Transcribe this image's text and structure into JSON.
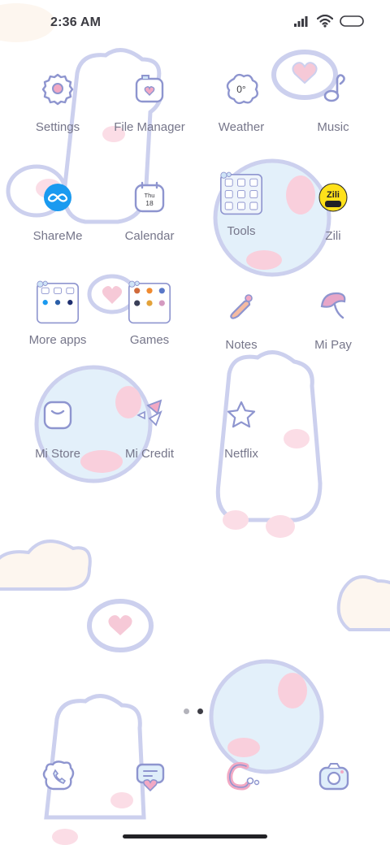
{
  "status_bar": {
    "time": "2:36 AM",
    "icons": [
      "signal-icon",
      "wifi-icon",
      "battery-icon"
    ]
  },
  "apps": [
    {
      "label": "Settings",
      "icon": "gear-icon"
    },
    {
      "label": "File Manager",
      "icon": "folder-icon"
    },
    {
      "label": "Weather",
      "icon": "weather-icon",
      "icon_text": "0°"
    },
    {
      "label": "Music",
      "icon": "music-note-icon"
    },
    {
      "label": "ShareMe",
      "icon": "shareme-icon"
    },
    {
      "label": "Calendar",
      "icon": "calendar-icon",
      "day": "Thu",
      "date": "18"
    },
    {
      "label": "Tools",
      "icon": "folder-tools-icon"
    },
    {
      "label": "Zili",
      "icon": "zili-icon",
      "icon_text": "Zili"
    },
    {
      "label": "More apps",
      "icon": "folder-more-apps-icon"
    },
    {
      "label": "Games",
      "icon": "folder-games-icon"
    },
    {
      "label": "Notes",
      "icon": "notes-icon"
    },
    {
      "label": "Mi Pay",
      "icon": "mi-pay-icon"
    },
    {
      "label": "Mi Store",
      "icon": "mi-store-icon"
    },
    {
      "label": "Mi Credit",
      "icon": "mi-credit-icon"
    },
    {
      "label": "Netflix",
      "icon": "star-icon"
    }
  ],
  "dock": [
    {
      "icon": "phone-icon"
    },
    {
      "icon": "messages-icon"
    },
    {
      "icon": "browser-icon"
    },
    {
      "icon": "camera-icon"
    }
  ],
  "page_indicator": {
    "pages": 2,
    "current": 2
  },
  "colors": {
    "icon_stroke": "#8e95cf",
    "label": "#76768a",
    "accent_pink": "#f2a9c4",
    "accent_blue": "#dfeefa",
    "wallpaper_line": "#c9cdec"
  }
}
